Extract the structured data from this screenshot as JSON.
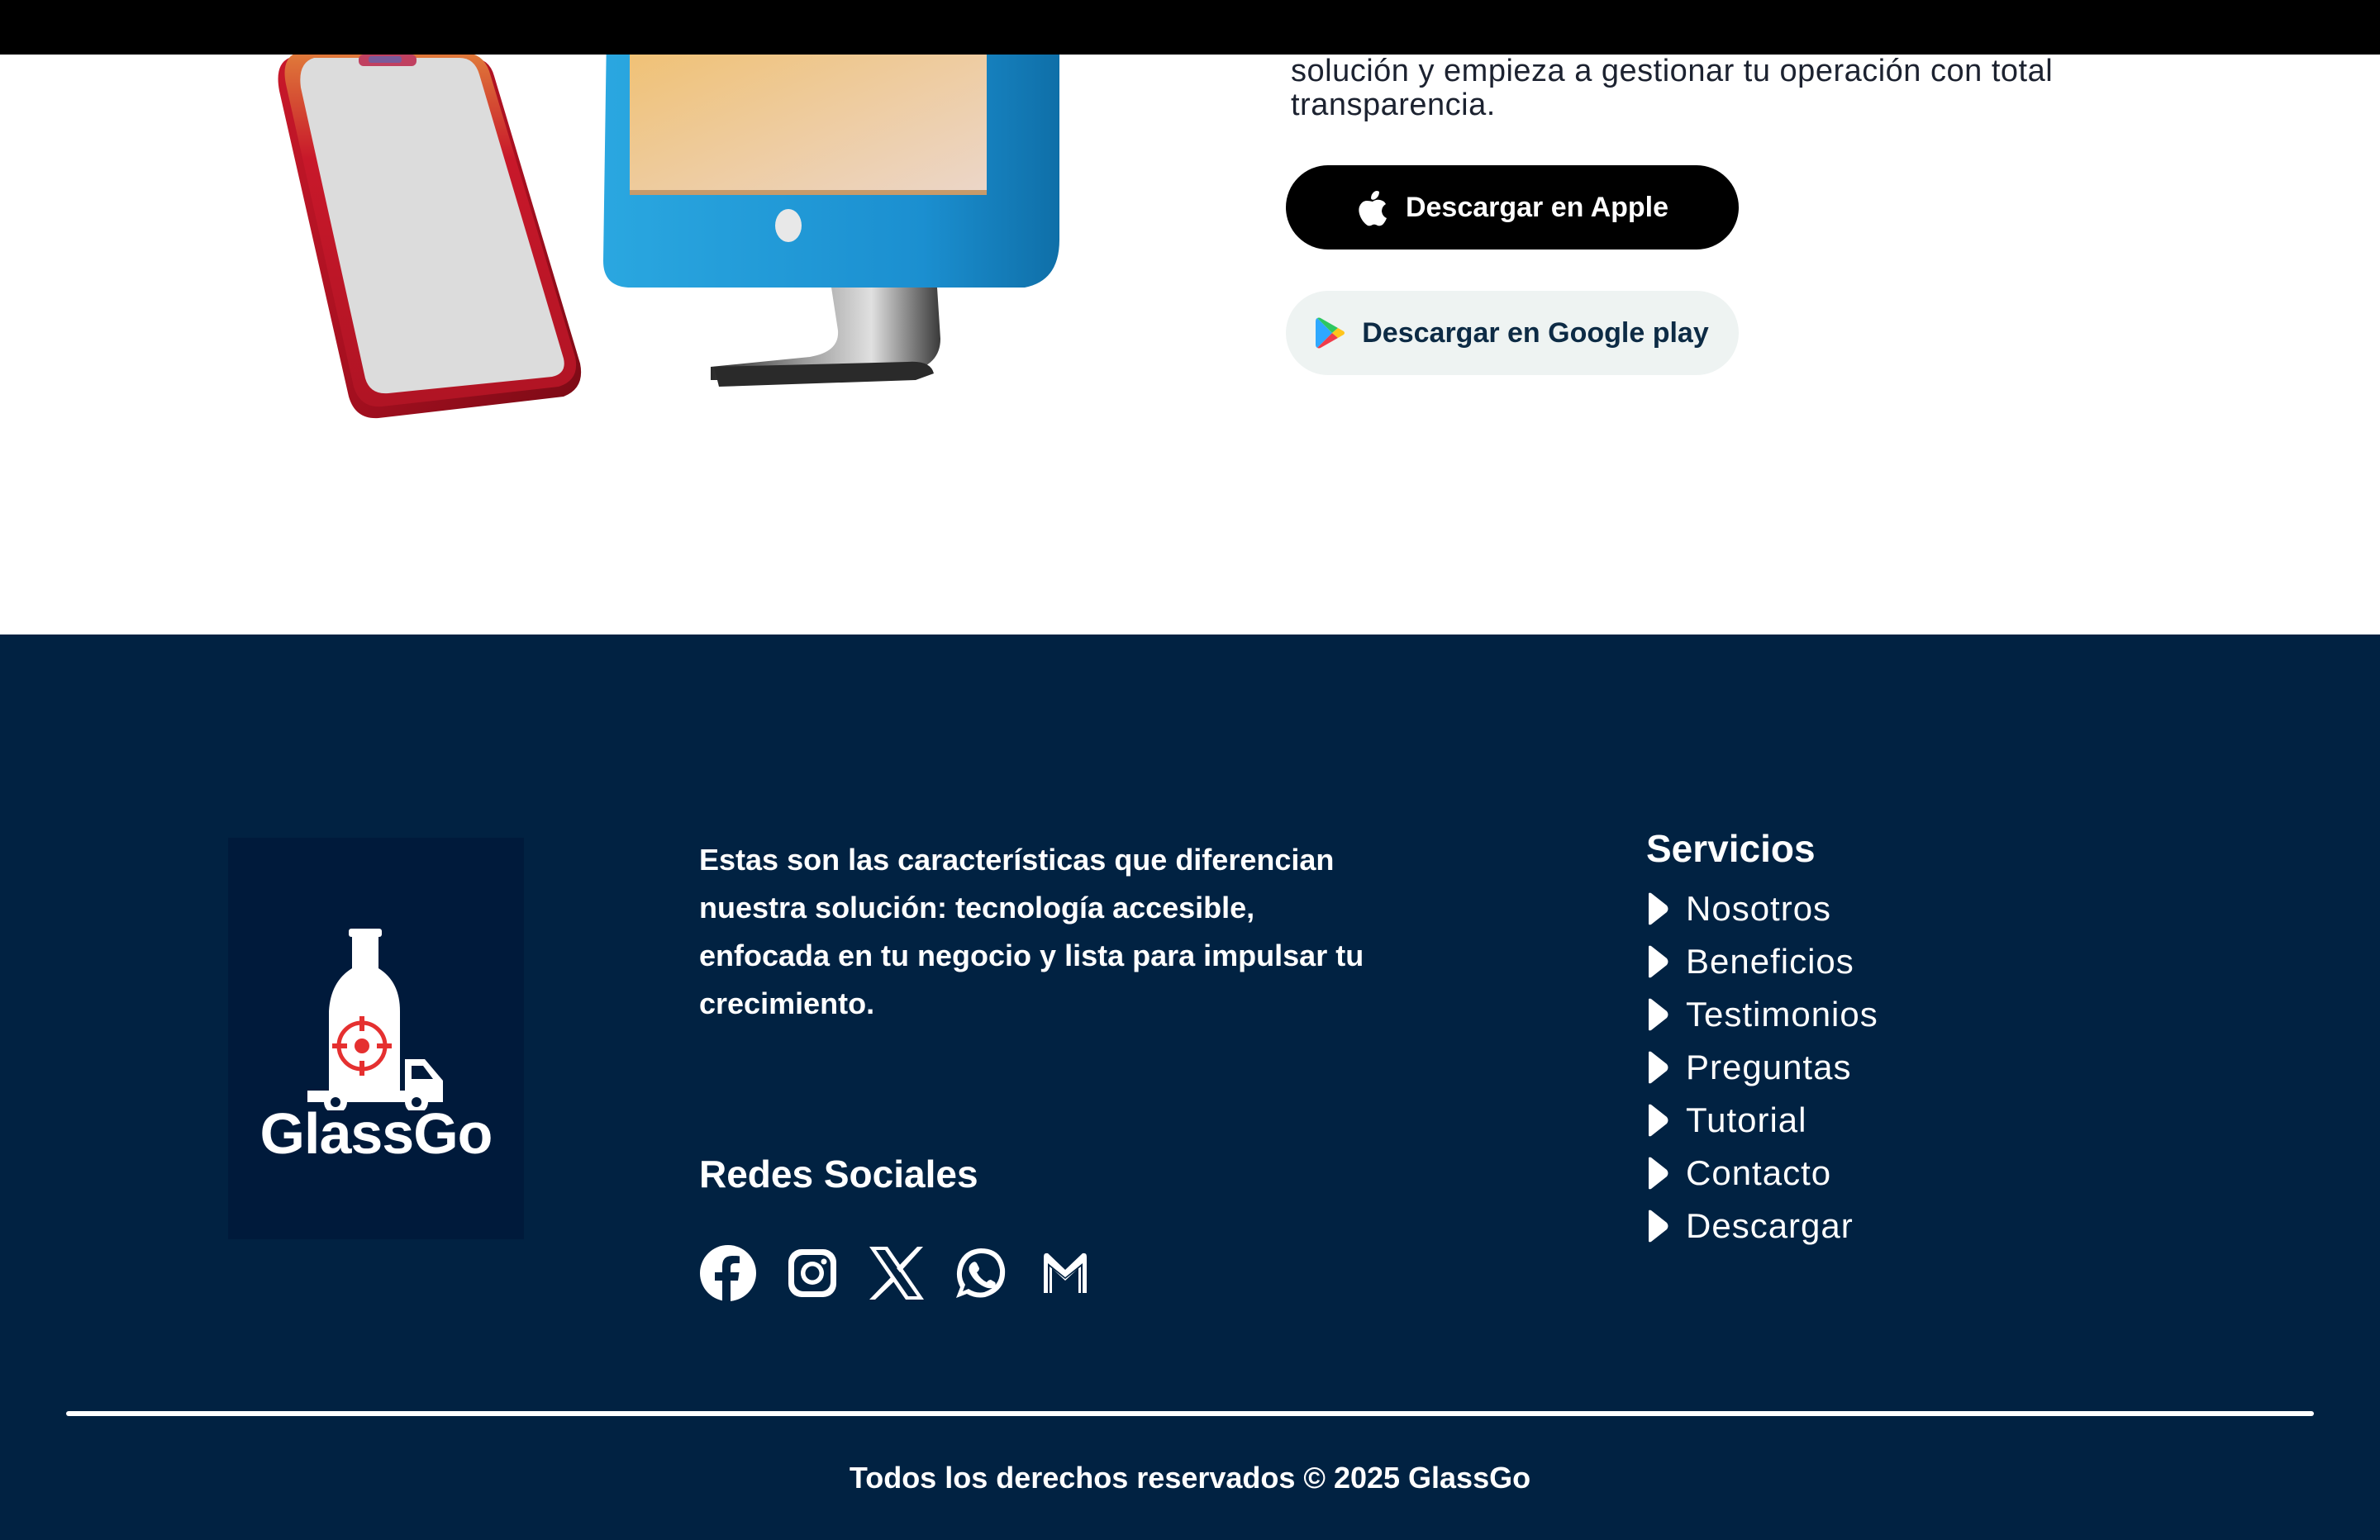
{
  "hero": {
    "text_line_1": "solución y empieza a gestionar tu operación con total",
    "text_line_2": "transparencia.",
    "apple_button": {
      "label": "Descargar en Apple",
      "icon": "apple-icon"
    },
    "google_button": {
      "label": "Descargar en Google play",
      "icon": "google-play-icon"
    }
  },
  "footer": {
    "logo_text": "GlassGo",
    "description": "Estas son las características que diferencian nuestra solución: tecnología accesible, enfocada en tu negocio y lista para impulsar tu crecimiento.",
    "social_title": "Redes Sociales",
    "social_icons": [
      "facebook-icon",
      "instagram-icon",
      "x-icon",
      "whatsapp-icon",
      "gmail-icon"
    ],
    "services_title": "Servicios",
    "services": [
      {
        "label": "Nosotros"
      },
      {
        "label": "Beneficios"
      },
      {
        "label": "Testimonios"
      },
      {
        "label": "Preguntas"
      },
      {
        "label": "Tutorial"
      },
      {
        "label": "Contacto"
      },
      {
        "label": "Descargar"
      }
    ],
    "copyright": "Todos los derechos reservados © 2025 GlassGo"
  },
  "colors": {
    "footer_bg": "#012242",
    "logo_bg": "#001a3b",
    "accent_red": "#e53030",
    "apple_button_bg": "#000000",
    "google_button_bg": "#eef3f2"
  }
}
